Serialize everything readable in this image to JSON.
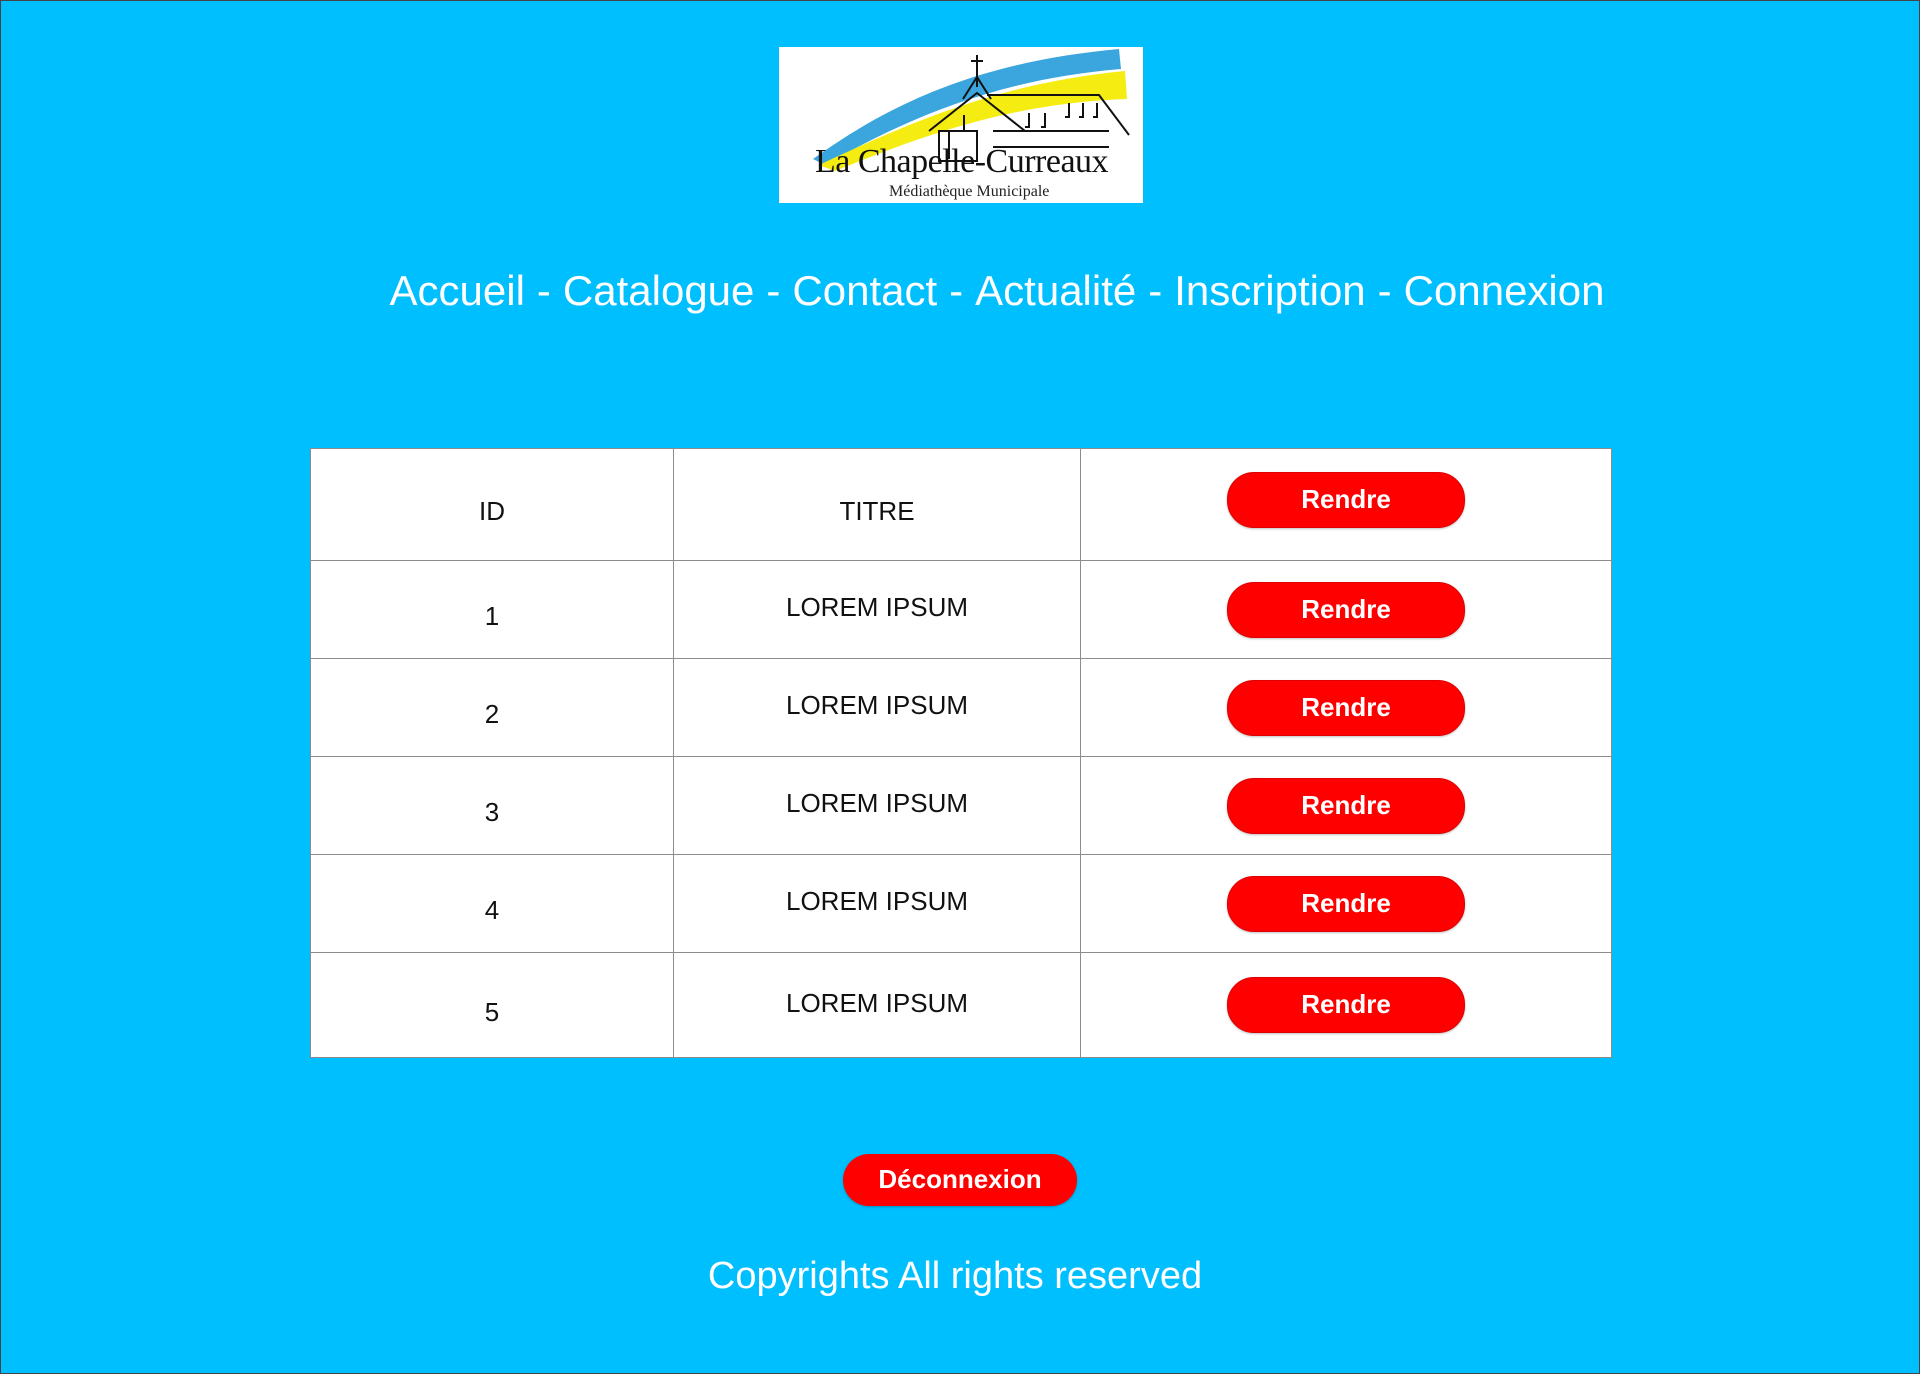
{
  "logo": {
    "title": "La Chapelle-Curreaux",
    "subtitle": "Médiathèque Municipale"
  },
  "nav": {
    "items": [
      "Accueil",
      "Catalogue",
      "Contact",
      "Actualité",
      "Inscription",
      "Connexion"
    ],
    "separator": "-"
  },
  "table": {
    "headers": {
      "id": "ID",
      "title": "TITRE",
      "action": "Rendre"
    },
    "rows": [
      {
        "id": "1",
        "title": "LOREM IPSUM",
        "action": "Rendre"
      },
      {
        "id": "2",
        "title": "LOREM IPSUM",
        "action": "Rendre"
      },
      {
        "id": "3",
        "title": "LOREM IPSUM",
        "action": "Rendre"
      },
      {
        "id": "4",
        "title": "LOREM IPSUM",
        "action": "Rendre"
      },
      {
        "id": "5",
        "title": "LOREM IPSUM",
        "action": "Rendre"
      }
    ]
  },
  "logout_label": "Déconnexion",
  "footer": "Copyrights All rights reserved",
  "colors": {
    "background": "#00BFFF",
    "button": "#FF0000",
    "text_light": "#FFFFFF"
  }
}
